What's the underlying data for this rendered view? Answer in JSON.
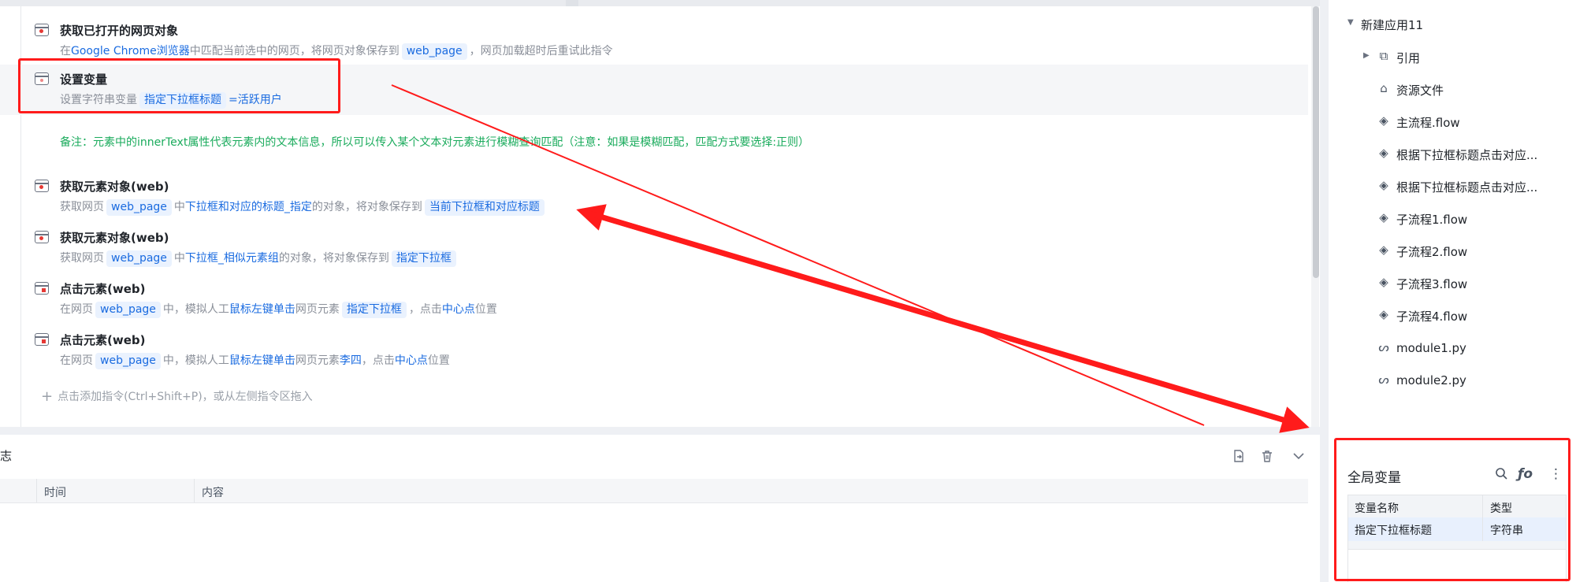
{
  "editor": {
    "commands": [
      {
        "title": "获取已打开的网页对象",
        "desc_prefix": "在",
        "desc_browser": "Google Chrome浏览器",
        "desc_mid": "中匹配当前选中的网页，将网页对象保存到",
        "desc_var": "web_page",
        "desc_suffix": "，网页加载超时后重试此指令"
      },
      {
        "title": "设置变量",
        "desc_prefix": "设置字符串变量",
        "desc_var": "指定下拉框标题",
        "desc_eq": "=",
        "desc_value": "活跃用户"
      },
      {
        "title": "获取元素对象(web)",
        "desc_prefix": "获取网页",
        "desc_var": "web_page",
        "desc_mid1": "中",
        "desc_elem": "下拉框和对应的标题_指定",
        "desc_mid2": "的对象，将对象保存到",
        "desc_out": "当前下拉框和对应标题"
      },
      {
        "title": "获取元素对象(web)",
        "desc_prefix": "获取网页",
        "desc_var": "web_page",
        "desc_mid1": "中",
        "desc_elem": "下拉框_相似元素组",
        "desc_mid2": "的对象，将对象保存到",
        "desc_out": "指定下拉框"
      },
      {
        "title": "点击元素(web)",
        "desc_prefix": "在网页",
        "desc_var": "web_page",
        "desc_mid1": "中，模拟人工",
        "desc_action": "鼠标左键单击",
        "desc_mid2": "网页元素",
        "desc_elem": "指定下拉框",
        "desc_mid3": "，点击",
        "desc_pos": "中心点",
        "desc_suffix": "位置"
      },
      {
        "title": "点击元素(web)",
        "desc_prefix": "在网页",
        "desc_var": "web_page",
        "desc_mid1": "中，模拟人工",
        "desc_action": "鼠标左键单击",
        "desc_mid2": "网页元素",
        "desc_elem": "李四",
        "desc_mid3": "，点击",
        "desc_pos": "中心点",
        "desc_suffix": "位置"
      }
    ],
    "note": "备注：元素中的innerText属性代表元素内的文本信息，所以可以传入某个文本对元素进行模糊查询匹配（注意：如果是模糊匹配，匹配方式要选择:正则）",
    "add_hint": "点击添加指令(Ctrl+Shift+P)，或从左侧指令区拖入",
    "add_icon": "plus-icon"
  },
  "log": {
    "title": "志",
    "columns": [
      "时间",
      "内容"
    ],
    "tools": [
      "export-icon",
      "trash-icon",
      "chevron-down-icon"
    ]
  },
  "project": {
    "root": "新建应用11",
    "items": [
      {
        "label": "引用",
        "icon": "reference-icon",
        "expandable": true
      },
      {
        "label": "资源文件",
        "icon": "resource-file-icon"
      },
      {
        "label": "主流程.flow",
        "icon": "flow-icon"
      },
      {
        "label": "根据下拉框标题点击对应...",
        "icon": "flow-icon"
      },
      {
        "label": "根据下拉框标题点击对应...",
        "icon": "flow-icon"
      },
      {
        "label": "子流程1.flow",
        "icon": "flow-icon"
      },
      {
        "label": "子流程2.flow",
        "icon": "flow-icon"
      },
      {
        "label": "子流程3.flow",
        "icon": "flow-icon"
      },
      {
        "label": "子流程4.flow",
        "icon": "flow-icon"
      },
      {
        "label": "module1.py",
        "icon": "python-icon"
      },
      {
        "label": "module2.py",
        "icon": "python-icon"
      }
    ]
  },
  "globals": {
    "title": "全局变量",
    "columns": [
      "变量名称",
      "类型"
    ],
    "rows": [
      {
        "name": "指定下拉框标题",
        "type": "字符串"
      }
    ],
    "tools": [
      "search-icon",
      "function-icon",
      "more-icon"
    ]
  },
  "colors": {
    "accent_blue": "#1a6be0",
    "chip_bg": "#eaf2fe",
    "note_green": "#1aab5c",
    "annotation_red": "#ff1b1b"
  }
}
